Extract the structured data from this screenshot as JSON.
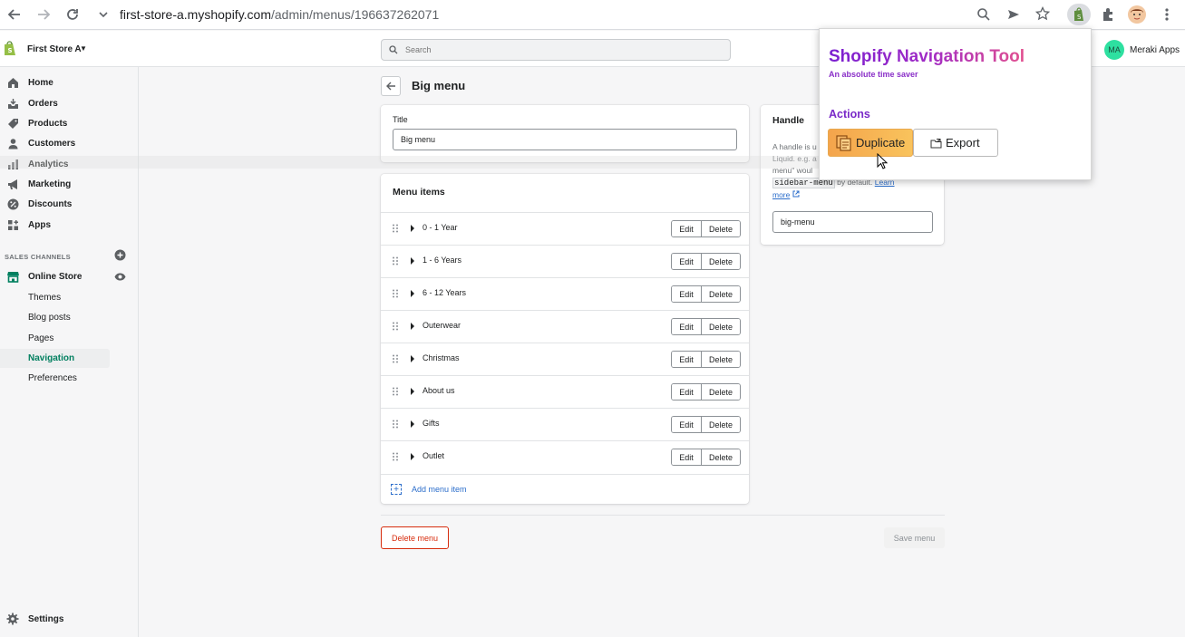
{
  "browser": {
    "url_host": "first-store-a.myshopify.com",
    "url_path": "/admin/menus/196637262071"
  },
  "topbar": {
    "store_name": "First Store A",
    "search_placeholder": "Search",
    "account_initials": "MA",
    "account_name": "Meraki Apps"
  },
  "sidebar": {
    "items": [
      {
        "label": "Home",
        "icon": "home-icon"
      },
      {
        "label": "Orders",
        "icon": "orders-icon"
      },
      {
        "label": "Products",
        "icon": "tag-icon"
      },
      {
        "label": "Customers",
        "icon": "person-icon"
      },
      {
        "label": "Analytics",
        "icon": "bar-chart-icon"
      },
      {
        "label": "Marketing",
        "icon": "megaphone-icon"
      },
      {
        "label": "Discounts",
        "icon": "discount-icon"
      },
      {
        "label": "Apps",
        "icon": "apps-icon"
      }
    ],
    "section_title": "SALES CHANNELS",
    "channel": "Online Store",
    "sub_items": [
      "Themes",
      "Blog posts",
      "Pages",
      "Navigation",
      "Preferences"
    ],
    "active_sub": "Navigation",
    "settings": "Settings"
  },
  "page": {
    "title": "Big menu",
    "title_label": "Title",
    "title_value": "Big menu",
    "menu_items_heading": "Menu items",
    "items": [
      "0 - 1 Year",
      "1 - 6 Years",
      "6 - 12 Years",
      "Outerwear",
      "Christmas",
      "About us",
      "Gifts",
      "Outlet"
    ],
    "edit_label": "Edit",
    "delete_label": "Delete",
    "add_item_label": "Add menu item",
    "handle_heading": "Handle",
    "handle_desc_1": "A handle is u",
    "handle_desc_2": "Liquid. e.g. a",
    "handle_desc_3": "menu\" woul",
    "handle_code": "sidebar-menu",
    "handle_desc_4": " by default. ",
    "handle_learn": "Learn",
    "handle_more": "more",
    "handle_value": "big-menu",
    "delete_menu_label": "Delete menu",
    "save_menu_label": "Save menu"
  },
  "popup": {
    "title": "Shopify Navigation Tool",
    "subtitle": "An absolute time saver",
    "actions_heading": "Actions",
    "duplicate_label": "Duplicate",
    "export_label": "Export"
  },
  "colors": {
    "shopify_green": "#008060",
    "link_blue": "#2c6ecb",
    "critical_red": "#d72c0d",
    "popup_purple": "#7a1fd0"
  }
}
